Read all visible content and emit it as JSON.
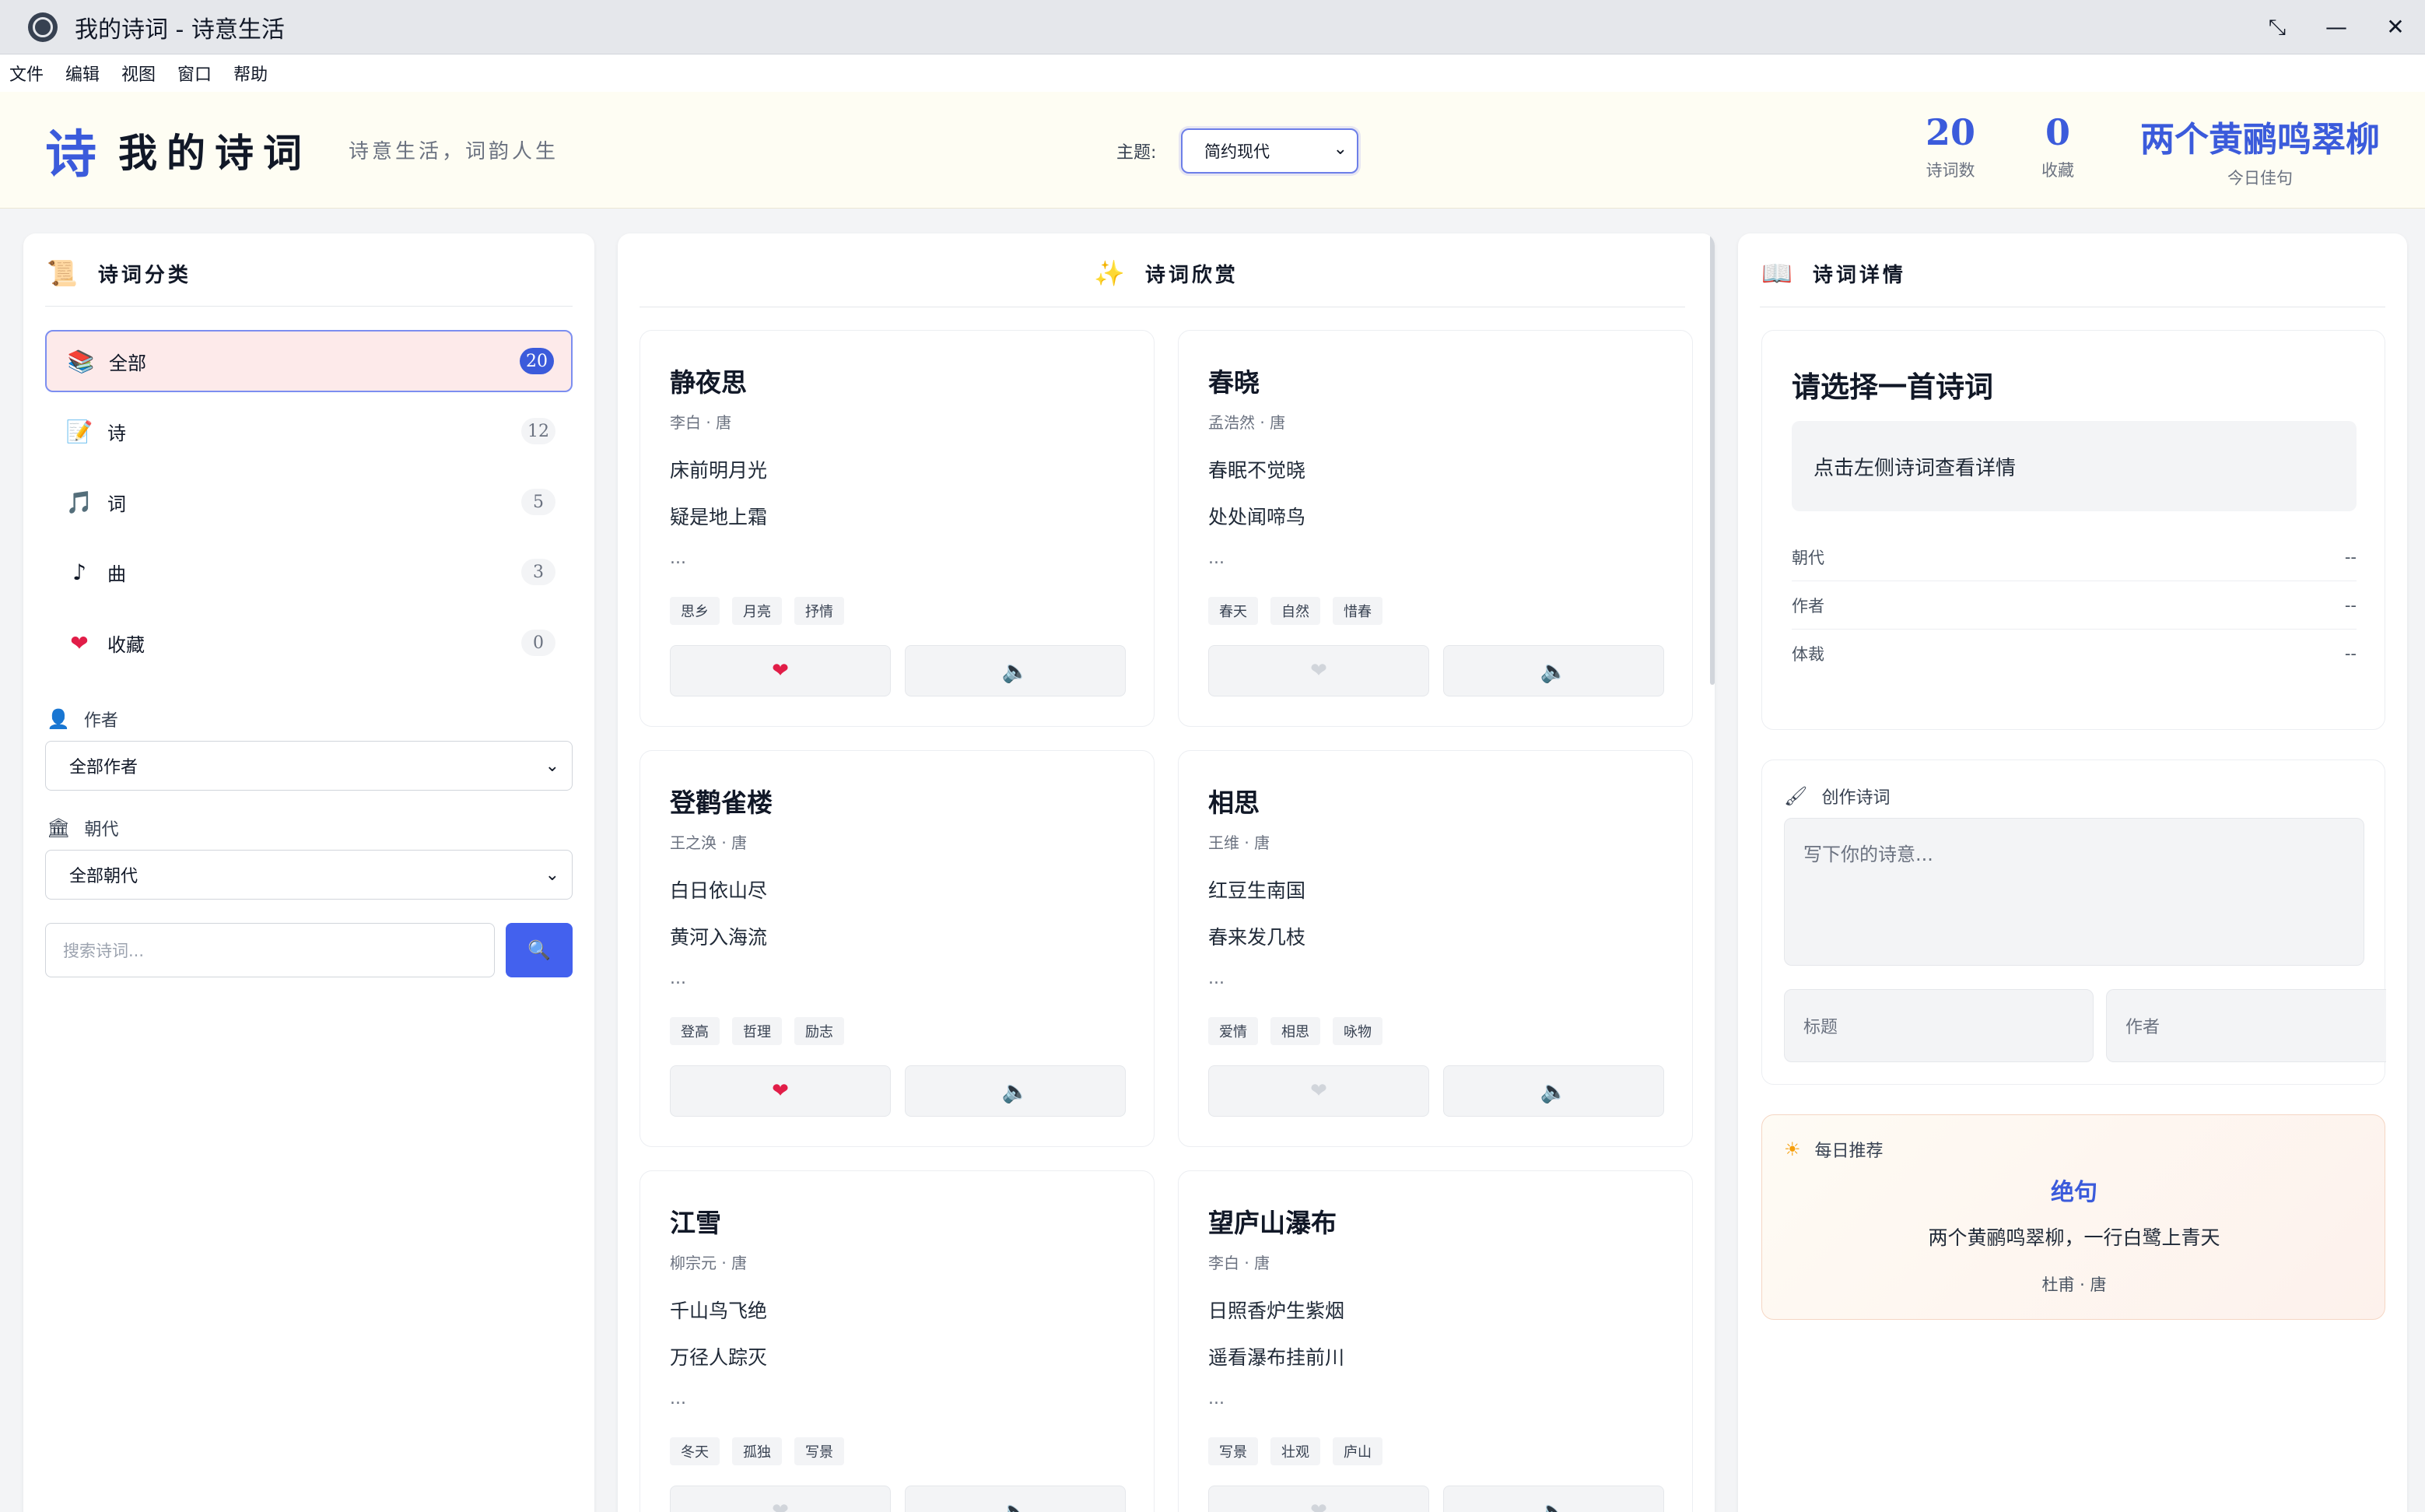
{
  "window": {
    "title": "我的诗词 - 诗意生活",
    "restore_glyph": "⤡",
    "minimize_glyph": "—",
    "close_glyph": "✕"
  },
  "menu": [
    "文件",
    "编辑",
    "视图",
    "窗口",
    "帮助"
  ],
  "header": {
    "logo_char": "诗",
    "app_name": "我的诗词",
    "slogan": "诗意生活，词韵人生",
    "theme_label": "主题:",
    "theme_value": "简约现代",
    "stats": {
      "poems_count": "20",
      "poems_label": "诗词数",
      "fav_count": "0",
      "fav_label": "收藏",
      "quote": "两个黄鹂鸣翠柳",
      "quote_label": "今日佳句"
    }
  },
  "sidebar": {
    "title": "诗词分类",
    "categories": [
      {
        "label": "全部",
        "count": "20",
        "icon": "books-icon",
        "glyph": "📚"
      },
      {
        "label": "诗",
        "count": "12",
        "icon": "memo-icon",
        "glyph": "📝"
      },
      {
        "label": "词",
        "count": "5",
        "icon": "music-note-icon",
        "glyph": "🎵"
      },
      {
        "label": "曲",
        "count": "3",
        "icon": "eighth-note-icon",
        "glyph": "♪"
      },
      {
        "label": "收藏",
        "count": "0",
        "icon": "heart-icon",
        "glyph": "❤"
      }
    ],
    "author_label": "作者",
    "author_value": "全部作者",
    "dynasty_label": "朝代",
    "dynasty_value": "全部朝代",
    "search_placeholder": "搜索诗词..."
  },
  "main": {
    "title": "诗词欣赏",
    "cards": [
      {
        "title": "静夜思",
        "meta": "李白 · 唐",
        "lines": [
          "床前明月光",
          "疑是地上霜"
        ],
        "ellipsis": "...",
        "tags": [
          "思乡",
          "月亮",
          "抒情"
        ],
        "favorited": true
      },
      {
        "title": "春晓",
        "meta": "孟浩然 · 唐",
        "lines": [
          "春眠不觉晓",
          "处处闻啼鸟"
        ],
        "ellipsis": "...",
        "tags": [
          "春天",
          "自然",
          "惜春"
        ],
        "favorited": false
      },
      {
        "title": "登鹳雀楼",
        "meta": "王之涣 · 唐",
        "lines": [
          "白日依山尽",
          "黄河入海流"
        ],
        "ellipsis": "...",
        "tags": [
          "登高",
          "哲理",
          "励志"
        ],
        "favorited": true
      },
      {
        "title": "相思",
        "meta": "王维 · 唐",
        "lines": [
          "红豆生南国",
          "春来发几枝"
        ],
        "ellipsis": "...",
        "tags": [
          "爱情",
          "相思",
          "咏物"
        ],
        "favorited": false
      },
      {
        "title": "江雪",
        "meta": "柳宗元 · 唐",
        "lines": [
          "千山鸟飞绝",
          "万径人踪灭"
        ],
        "ellipsis": "...",
        "tags": [
          "冬天",
          "孤独",
          "写景"
        ],
        "favorited": false
      },
      {
        "title": "望庐山瀑布",
        "meta": "李白 · 唐",
        "lines": [
          "日照香炉生紫烟",
          "遥看瀑布挂前川"
        ],
        "ellipsis": "...",
        "tags": [
          "写景",
          "壮观",
          "庐山"
        ],
        "favorited": false
      }
    ]
  },
  "detail": {
    "title": "诗词详情",
    "placeholder_title": "请选择一首诗词",
    "hint": "点击左侧诗词查看详情",
    "rows": [
      {
        "label": "朝代",
        "value": "--"
      },
      {
        "label": "作者",
        "value": "--"
      },
      {
        "label": "体裁",
        "value": "--"
      }
    ]
  },
  "compose": {
    "label": "创作诗词",
    "textarea_placeholder": "写下你的诗意...",
    "title_placeholder": "标题",
    "author_placeholder": "作者"
  },
  "daily": {
    "label": "每日推荐",
    "title": "绝句",
    "line": "两个黄鹂鸣翠柳，一行白鹭上青天",
    "author": "杜甫 · 唐"
  },
  "colors": {
    "accent": "#3b5bdb",
    "favorite": "#e11d48",
    "header_bg": "#fefdf3"
  }
}
